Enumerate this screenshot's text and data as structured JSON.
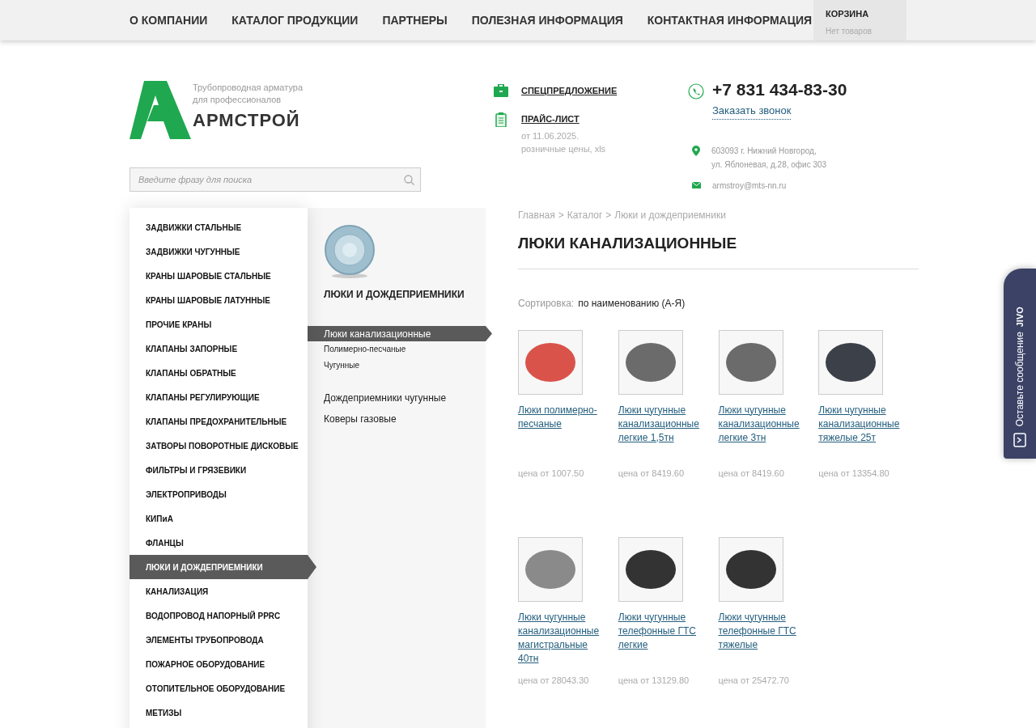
{
  "nav": {
    "items": [
      {
        "label": "О КОМПАНИИ"
      },
      {
        "label": "КАТАЛОГ ПРОДУКЦИИ"
      },
      {
        "label": "ПАРТНЕРЫ"
      },
      {
        "label": "ПОЛЕЗНАЯ ИНФОРМАЦИЯ"
      },
      {
        "label": "КОНТАКТНАЯ ИНФОРМАЦИЯ"
      }
    ],
    "cart": {
      "title": "КОРЗИНА",
      "status": "Нет товаров"
    }
  },
  "logo": {
    "tagline_1": "Трубопроводная арматура",
    "tagline_2": "для профессионалов",
    "name": "АРМСТРОЙ"
  },
  "search": {
    "placeholder": "Введите фразу для поиска"
  },
  "links": [
    {
      "kind": "briefcase",
      "label": "СПЕЦПРЕДЛОЖЕНИЕ"
    },
    {
      "kind": "clipboard",
      "label": "ПРАЙС-ЛИСТ",
      "note_1": "от 11.06.2025.",
      "note_2": "розничные цены, xls"
    }
  ],
  "contacts": {
    "phone": "+7 831 434-83-30",
    "callback": "Заказать звонок",
    "address_1": "603093 г. Нижний Новгород,",
    "address_2": "ул. Яблоневая, д.28, офис 303",
    "email": "armstroy@mts-nn.ru"
  },
  "categories": [
    {
      "label": "ЗАДВИЖКИ СТАЛЬНЫЕ",
      "selected": false
    },
    {
      "label": "ЗАДВИЖКИ ЧУГУННЫЕ",
      "selected": false
    },
    {
      "label": "КРАНЫ ШАРОВЫЕ СТАЛЬНЫЕ",
      "selected": false
    },
    {
      "label": "КРАНЫ ШАРОВЫЕ ЛАТУННЫЕ",
      "selected": false
    },
    {
      "label": "ПРОЧИЕ КРАНЫ",
      "selected": false
    },
    {
      "label": "КЛАПАНЫ ЗАПОРНЫЕ",
      "selected": false
    },
    {
      "label": "КЛАПАНЫ ОБРАТНЫЕ",
      "selected": false
    },
    {
      "label": "КЛАПАНЫ РЕГУЛИРУЮЩИЕ",
      "selected": false
    },
    {
      "label": "КЛАПАНЫ ПРЕДОХРАНИТЕЛЬНЫЕ",
      "selected": false
    },
    {
      "label": "ЗАТВОРЫ ПОВОРОТНЫЕ ДИСКОВЫЕ",
      "selected": false
    },
    {
      "label": "ФИЛЬТРЫ И ГРЯЗЕВИКИ",
      "selected": false
    },
    {
      "label": "ЭЛЕКТРОПРИВОДЫ",
      "selected": false
    },
    {
      "label": "КИПиА",
      "selected": false
    },
    {
      "label": "ФЛАНЦЫ",
      "selected": false
    },
    {
      "label": "ЛЮКИ И ДОЖДЕПРИЕМНИКИ",
      "selected": true
    },
    {
      "label": "КАНАЛИЗАЦИЯ",
      "selected": false
    },
    {
      "label": "ВОДОПРОВОД НАПОРНЫЙ PPRC",
      "selected": false
    },
    {
      "label": "ЭЛЕМЕНТЫ ТРУБОПРОВОДА",
      "selected": false
    },
    {
      "label": "ПОЖАРНОЕ ОБОРУДОВАНИЕ",
      "selected": false
    },
    {
      "label": "ОТОПИТЕЛЬНОЕ ОБОРУДОВАНИЕ",
      "selected": false
    },
    {
      "label": "МЕТИЗЫ",
      "selected": false
    }
  ],
  "subpanel": {
    "title": "ЛЮКИ И ДОЖДЕПРИЕМНИКИ",
    "items": [
      {
        "label": "Люки канализационные",
        "selected": true,
        "children": [
          {
            "label": "Полимерно-песчаные"
          },
          {
            "label": "Чугунные"
          }
        ]
      },
      {
        "label": "Дождеприемники чугунные",
        "selected": false
      },
      {
        "label": "Коверы газовые",
        "selected": false
      }
    ]
  },
  "breadcrumb": [
    "Главная",
    "Каталог",
    "Люки и дождеприемники"
  ],
  "breadcrumb_separator": ">",
  "heading": "ЛЮКИ КАНАЛИЗАЦИОННЫЕ",
  "sort": {
    "label": "Сортировка:",
    "value": "по наименованию (А-Я)"
  },
  "products": [
    {
      "name": "Люки полимерно-песчаные",
      "price": "цена от 1007.50",
      "color": "#d9534a"
    },
    {
      "name": "Люки чугунные канализационные легкие 1,5тн",
      "price": "цена от 8419.60",
      "color": "#6b6b6b"
    },
    {
      "name": "Люки чугунные канализационные легкие 3тн",
      "price": "цена от 8419.60",
      "color": "#6b6b6b"
    },
    {
      "name": "Люки чугунные канализационные тяжелые 25т",
      "price": "цена от 13354.80",
      "color": "#3c4048"
    },
    {
      "name": "Люки чугунные канализационные магистральные 40тн",
      "price": "цена от 28043.30",
      "color": "#8a8a8a"
    },
    {
      "name": "Люки чугунные телефонные ГТС легкие",
      "price": "цена от 13129.80",
      "color": "#333333"
    },
    {
      "name": "Люки чугунные телефонные ГТС тяжелые",
      "price": "цена от 25472.70",
      "color": "#333333"
    }
  ],
  "chat": {
    "label": "Оставьте сообщение",
    "brand": "JIVO"
  }
}
